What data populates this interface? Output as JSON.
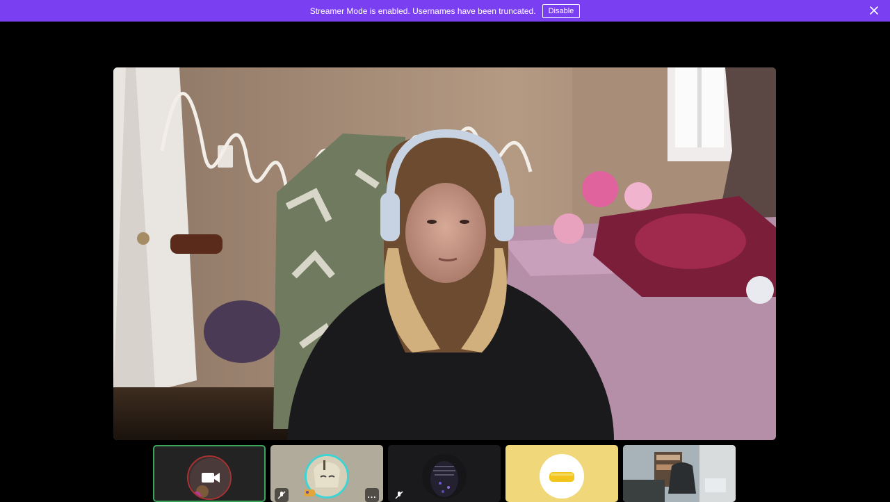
{
  "banner": {
    "message": "Streamer Mode is enabled. Usernames have been truncated.",
    "disable_label": "Disable",
    "background": "#7b3ff2"
  },
  "main_video": {
    "description_icon": "webcam-stream"
  },
  "participants": [
    {
      "slot": 1,
      "state": "camera-off",
      "icon": "video-camera-icon",
      "speaking": true,
      "ring_color": "#3ba55c"
    },
    {
      "slot": 2,
      "state": "avatar",
      "muted": true,
      "has_more_menu": true
    },
    {
      "slot": 3,
      "state": "avatar",
      "muted": true
    },
    {
      "slot": 4,
      "state": "avatar",
      "tile_color": "#f0d87a"
    },
    {
      "slot": 5,
      "state": "video"
    }
  ],
  "more_label": "..."
}
